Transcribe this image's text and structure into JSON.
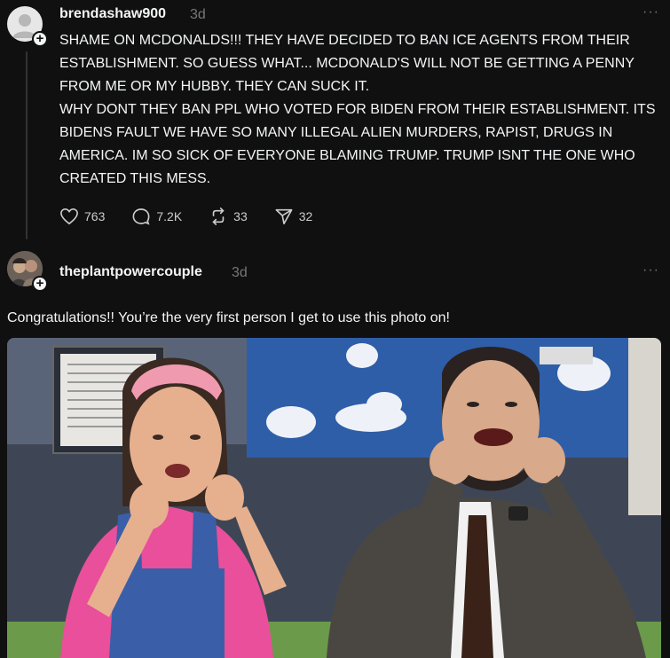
{
  "posts": [
    {
      "username": "brendashaw900",
      "time": "3d",
      "more_label": "···",
      "text": "SHAME ON MCDONALDS!!! THEY HAVE DECIDED TO BAN ICE AGENTS FROM THEIR ESTABLISHMENT. SO GUESS WHAT... MCDONALD'S WILL NOT BE GETTING A PENNY FROM ME OR MY HUBBY. THEY CAN SUCK IT.\nWHY DONT THEY BAN PPL WHO VOTED FOR BIDEN FROM THEIR ESTABLISHMENT. ITS BIDENS FAULT WE HAVE SO MANY ILLEGAL ALIEN MURDERS, RAPIST, DRUGS IN AMERICA. IM SO SICK OF EVERYONE BLAMING TRUMP. TRUMP ISNT THE ONE WHO CREATED THIS MESS.",
      "actions": {
        "likes": "763",
        "replies": "7.2K",
        "reposts": "33",
        "shares": "32"
      }
    },
    {
      "username": "theplantpowercouple",
      "time": "3d",
      "more_label": "···",
      "text": "Congratulations!! You’re the very first person I get to use this photo on!"
    }
  ],
  "colors": {
    "background": "#101010",
    "text": "#f3f5f7",
    "muted": "#777777",
    "thread_line": "#333333"
  },
  "icons": [
    "default-avatar-icon",
    "follow-plus-icon",
    "more-icon",
    "heart-icon",
    "comment-icon",
    "repost-icon",
    "share-icon"
  ]
}
